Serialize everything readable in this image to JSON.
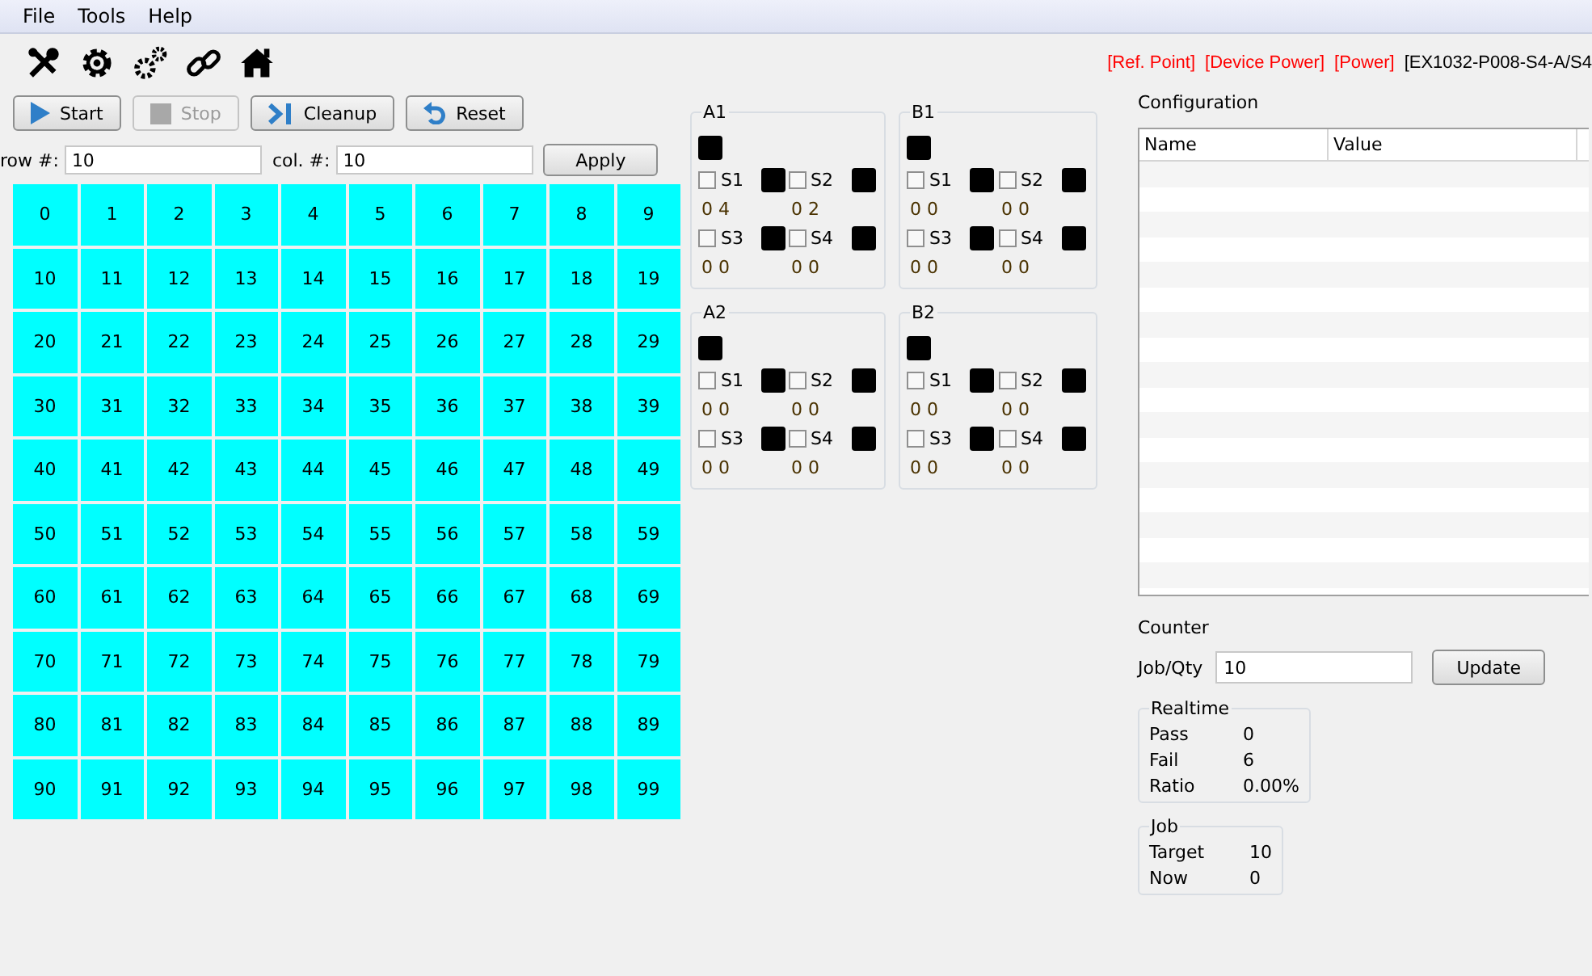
{
  "menu": [
    "File",
    "Tools",
    "Help"
  ],
  "status": [
    {
      "text": "[Ref. Point]",
      "color": "#ff0000"
    },
    {
      "text": "[Device Power]",
      "color": "#ff0000"
    },
    {
      "text": "[Power]",
      "color": "#ff0000"
    },
    {
      "text": "[EX1032-P008-S4-A/S4",
      "color": "#000000"
    }
  ],
  "buttons": [
    {
      "label": "Start",
      "kind": "start",
      "disabled": false
    },
    {
      "label": "Stop",
      "kind": "stop",
      "disabled": true
    },
    {
      "label": "Cleanup",
      "kind": "cleanup",
      "disabled": false
    },
    {
      "label": "Reset",
      "kind": "reset",
      "disabled": false
    }
  ],
  "row_field": {
    "label": "row #:",
    "value": "10"
  },
  "col_field": {
    "label": "col. #:",
    "value": "10"
  },
  "apply_button": "Apply",
  "grid": {
    "cells": [
      "0",
      "1",
      "2",
      "3",
      "4",
      "5",
      "6",
      "7",
      "8",
      "9",
      "10",
      "11",
      "12",
      "13",
      "14",
      "15",
      "16",
      "17",
      "18",
      "19",
      "20",
      "21",
      "22",
      "23",
      "24",
      "25",
      "26",
      "27",
      "28",
      "29",
      "30",
      "31",
      "32",
      "33",
      "34",
      "35",
      "36",
      "37",
      "38",
      "39",
      "40",
      "41",
      "42",
      "43",
      "44",
      "45",
      "46",
      "47",
      "48",
      "49",
      "50",
      "51",
      "52",
      "53",
      "54",
      "55",
      "56",
      "57",
      "58",
      "59",
      "60",
      "61",
      "62",
      "63",
      "64",
      "65",
      "66",
      "67",
      "68",
      "69",
      "70",
      "71",
      "72",
      "73",
      "74",
      "75",
      "76",
      "77",
      "78",
      "79",
      "80",
      "81",
      "82",
      "83",
      "84",
      "85",
      "86",
      "87",
      "88",
      "89",
      "90",
      "91",
      "92",
      "93",
      "94",
      "95",
      "96",
      "97",
      "98",
      "99"
    ]
  },
  "stations": [
    {
      "title": "A1",
      "sensors": [
        {
          "label": "S1",
          "checked": false,
          "reading": "0 4"
        },
        {
          "label": "S2",
          "checked": false,
          "reading": "0 2"
        },
        {
          "label": "S3",
          "checked": false,
          "reading": "0 0"
        },
        {
          "label": "S4",
          "checked": false,
          "reading": "0 0"
        }
      ]
    },
    {
      "title": "B1",
      "sensors": [
        {
          "label": "S1",
          "checked": false,
          "reading": "0 0"
        },
        {
          "label": "S2",
          "checked": false,
          "reading": "0 0"
        },
        {
          "label": "S3",
          "checked": false,
          "reading": "0 0"
        },
        {
          "label": "S4",
          "checked": false,
          "reading": "0 0"
        }
      ]
    },
    {
      "title": "A2",
      "sensors": [
        {
          "label": "S1",
          "checked": false,
          "reading": "0 0"
        },
        {
          "label": "S2",
          "checked": false,
          "reading": "0 0"
        },
        {
          "label": "S3",
          "checked": false,
          "reading": "0 0"
        },
        {
          "label": "S4",
          "checked": false,
          "reading": "0 0"
        }
      ]
    },
    {
      "title": "B2",
      "sensors": [
        {
          "label": "S1",
          "checked": false,
          "reading": "0 0"
        },
        {
          "label": "S2",
          "checked": false,
          "reading": "0 0"
        },
        {
          "label": "S3",
          "checked": false,
          "reading": "0 0"
        },
        {
          "label": "S4",
          "checked": false,
          "reading": "0 0"
        }
      ]
    }
  ],
  "configuration": {
    "title": "Configuration",
    "columns": [
      "Name",
      "Value"
    ]
  },
  "counter": {
    "title": "Counter",
    "field_label": "Job/Qty",
    "value": "10",
    "button": "Update",
    "realtime": {
      "title": "Realtime",
      "rows": [
        {
          "label": "Pass",
          "value": "0"
        },
        {
          "label": "Fail",
          "value": "6"
        },
        {
          "label": "Ratio",
          "value": "0.00%"
        }
      ]
    },
    "job": {
      "title": "Job",
      "rows": [
        {
          "label": "Target",
          "value": "10"
        },
        {
          "label": "Now",
          "value": "0"
        }
      ]
    }
  }
}
